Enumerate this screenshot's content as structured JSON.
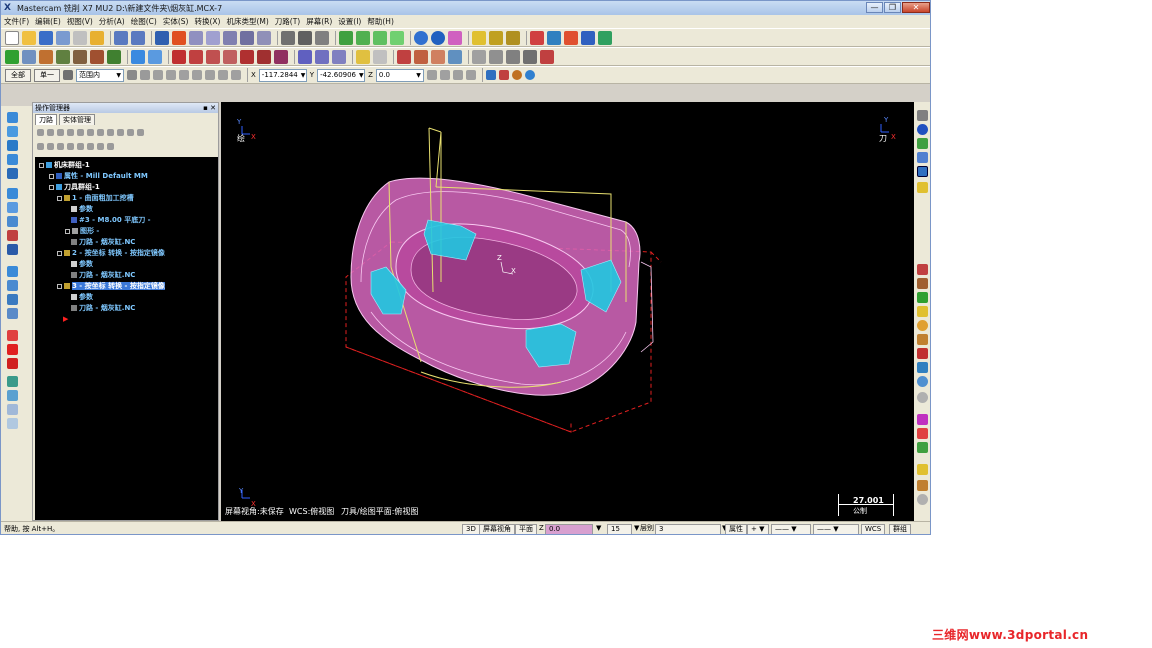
{
  "window": {
    "title": "Mastercam 铣削 X7 MU2  D:\\新建文件夹\\烟灰缸.MCX-7",
    "controls": [
      "—",
      "❐",
      "✕"
    ]
  },
  "menu": [
    "文件(F)",
    "编辑(E)",
    "视图(V)",
    "分析(A)",
    "绘图(C)",
    "实体(S)",
    "转换(X)",
    "机床类型(M)",
    "刀路(T)",
    "屏幕(R)",
    "设置(I)",
    "帮助(H)"
  ],
  "toolbar3": {
    "all_button": "全部",
    "single_button": "单一",
    "range_combo": "范围内",
    "x_label": "X",
    "x_value": "-117.2844",
    "y_label": "Y",
    "y_value": "-42.60906",
    "z_label": "Z",
    "z_value": "0.0"
  },
  "ops_manager": {
    "title": "操作管理器",
    "tabs": [
      "刀路",
      "实体管理"
    ],
    "tree": [
      "机床群组-1",
      "属性 - Mill Default MM",
      "刀具群组-1",
      "1 - 曲面粗加工挖槽",
      "参数",
      "#3 - M8.00 平底刀 -",
      "图形 -",
      "刀路 - 烟灰缸.NC",
      "2 - 按坐标 转换 - 按指定镜像",
      "参数",
      "刀路 - 烟灰缸.NC",
      "3 - 按坐标 转换 - 按指定镜像",
      "参数",
      "刀路 - 烟灰缸.NC"
    ]
  },
  "graphics": {
    "top_left_label": "绘",
    "top_right_label": "刀",
    "axis_y": "Y",
    "axis_x": "X",
    "axis_z": "Z",
    "bottom_info_1": "屏幕视角:未保存",
    "bottom_info_2": "WCS:俯视图",
    "bottom_info_3": "刀具/绘图平面:俯视图",
    "scale_value": "27.001",
    "scale_unit": "公制",
    "colors": {
      "part_fill": "#e070c8",
      "part_edge": "#f8c8f0",
      "pocket_fill": "#20c8e0",
      "boundary": "#e8e070",
      "stock_box": "#e02020"
    }
  },
  "status": {
    "hint": "帮助, 按 Alt+H。",
    "btn_3d": "3D",
    "btn_screen_view": "屏幕视角",
    "btn_plane": "平面",
    "z_label": "Z",
    "z_value": "0.0",
    "color_value": "15",
    "level_label": "层别",
    "level_value": "3",
    "attr_label": "属性",
    "wcs": "WCS",
    "group": "群组"
  },
  "watermark": "三维网www.3dportal.cn"
}
